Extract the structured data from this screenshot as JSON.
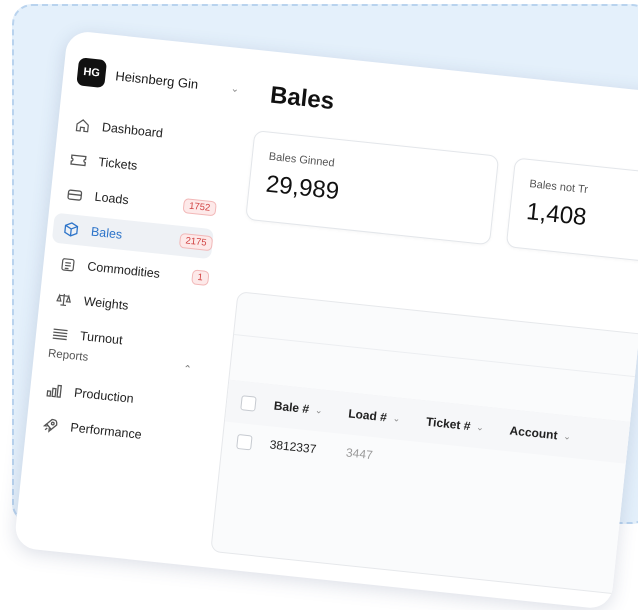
{
  "brand": {
    "initials": "HG",
    "name": "Heisnberg Gin"
  },
  "nav": [
    {
      "label": "Dashboard",
      "icon": "home-icon"
    },
    {
      "label": "Tickets",
      "icon": "ticket-icon"
    },
    {
      "label": "Loads",
      "icon": "tray-icon",
      "badge": "1752"
    },
    {
      "label": "Bales",
      "icon": "cube-icon",
      "badge": "2175",
      "active": true
    },
    {
      "label": "Commodities",
      "icon": "document-icon",
      "badge": "1"
    },
    {
      "label": "Weights",
      "icon": "scale-icon"
    },
    {
      "label": "Turnout",
      "icon": "lines-icon"
    }
  ],
  "reports": {
    "header": "Reports",
    "items": [
      {
        "label": "Production",
        "icon": "bar-chart-icon"
      },
      {
        "label": "Performance",
        "icon": "rocket-icon"
      }
    ]
  },
  "page": {
    "title": "Bales"
  },
  "stats": [
    {
      "label": "Bales Ginned",
      "value": "29,989"
    },
    {
      "label": "Bales not Tr",
      "value": "1,408"
    }
  ],
  "table": {
    "columns": [
      "Bale #",
      "Load #",
      "Ticket #",
      "Account"
    ],
    "rows": [
      [
        "3812337",
        "3447",
        "",
        ""
      ]
    ]
  },
  "colors": {
    "accent": "#2d74c9",
    "badge_text": "#d04040",
    "background": "#e4f0fb"
  }
}
